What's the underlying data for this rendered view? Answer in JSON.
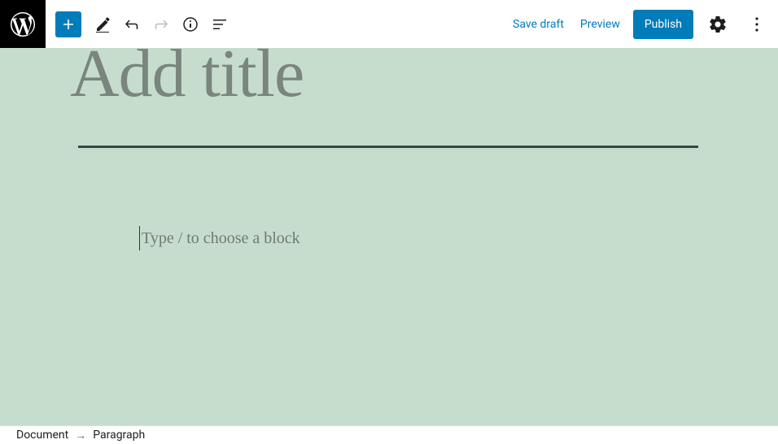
{
  "toolbar": {
    "save_draft_label": "Save draft",
    "preview_label": "Preview",
    "publish_label": "Publish"
  },
  "editor": {
    "title_placeholder": "Add title",
    "block_placeholder": "Type / to choose a block"
  },
  "breadcrumb": {
    "root": "Document",
    "current": "Paragraph"
  }
}
